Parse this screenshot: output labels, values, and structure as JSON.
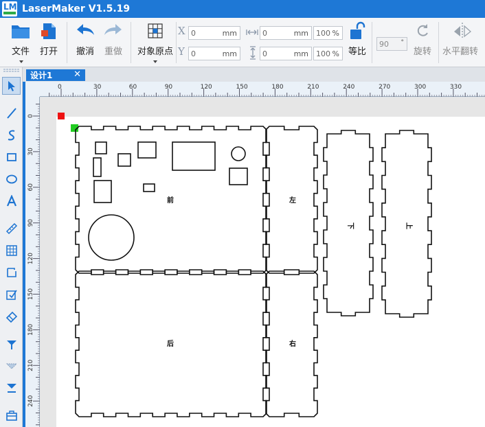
{
  "app": {
    "title": "LaserMaker V1.5.19",
    "logo_text": "LM"
  },
  "toolbar": {
    "file": "文件",
    "open": "打开",
    "undo": "撤消",
    "redo": "重做",
    "object_origin": "对象原点",
    "x_label": "X",
    "y_label": "Y",
    "x_value": "0",
    "y_value": "0",
    "width_value": "0",
    "height_value": "0",
    "unit": "mm",
    "width_pct": "100",
    "height_pct": "100",
    "pct_unit": "%",
    "proportional": "等比",
    "angle_value": "90",
    "angle_unit": "°",
    "rotate": "旋转",
    "flip_horizontal": "水平翻转"
  },
  "tabs": [
    {
      "label": "设计1",
      "close": "✕"
    }
  ],
  "ruler": {
    "top_labels": [
      "0",
      "30",
      "60",
      "90",
      "120",
      "150",
      "180",
      "210",
      "240",
      "270",
      "300",
      "330"
    ],
    "left_labels": [
      "0",
      "30",
      "60",
      "90",
      "120",
      "150",
      "180",
      "210",
      "240"
    ]
  },
  "panels": [
    {
      "name": "front",
      "label": "前"
    },
    {
      "name": "left",
      "label": "左"
    },
    {
      "name": "bottom",
      "label": "下"
    },
    {
      "name": "top",
      "label": "上"
    },
    {
      "name": "back",
      "label": "后"
    },
    {
      "name": "right",
      "label": "右"
    }
  ],
  "colors": {
    "accent": "#1e78d6",
    "origin_marker": "#ee1111",
    "selection_marker": "#22cc22"
  },
  "tools": [
    "select-arrow-icon",
    "line-icon",
    "curve-icon",
    "rectangle-icon",
    "ellipse-icon",
    "text-icon",
    "ruler-icon",
    "array-icon",
    "rect-dashed-icon",
    "edit-check-icon",
    "eraser-icon",
    "layer-down-icon",
    "layer-middle-icon",
    "layer-bottom-icon",
    "toolbox-icon"
  ]
}
